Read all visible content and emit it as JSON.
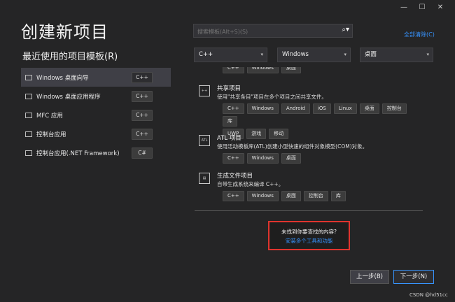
{
  "window": {
    "minimize": "—",
    "maximize": "☐",
    "close": "✕"
  },
  "title": "创建新项目",
  "recent": {
    "heading": "最近使用的项目模板(R)",
    "items": [
      {
        "label": "Windows 桌面向导",
        "tag": "C++",
        "selected": true
      },
      {
        "label": "Windows 桌面应用程序",
        "tag": "C++"
      },
      {
        "label": "MFC 应用",
        "tag": "C++"
      },
      {
        "label": "控制台应用",
        "tag": "C++"
      },
      {
        "label": "控制台应用(.NET Framework)",
        "tag": "C#"
      }
    ]
  },
  "search": {
    "placeholder": "搜索模板(Alt+S)(S)",
    "icon": "search-icon"
  },
  "clear_all": "全部清除(C)",
  "filters": {
    "language": "C++",
    "platform": "Windows",
    "project_type": "桌面"
  },
  "templates": {
    "partial_top_tags": [
      "C++",
      "Windows",
      "桌面"
    ],
    "items": [
      {
        "name": "共享项目",
        "desc": "使用\"共享条目\"项目在多个项目之间共享文件。",
        "tags": [
          "C++",
          "Windows",
          "Android",
          "iOS",
          "Linux",
          "桌面",
          "控制台",
          "库",
          "UWP",
          "游戏",
          "移动"
        ]
      },
      {
        "name": "ATL 项目",
        "desc": "使用活动模板库(ATL)创建小型快速的组件对象模型(COM)对象。",
        "tags": [
          "C++",
          "Windows",
          "桌面"
        ]
      },
      {
        "name": "生成文件项目",
        "desc": "自带生成系统来编译 C++。",
        "tags": [
          "C++",
          "Windows",
          "桌面",
          "控制台",
          "库"
        ]
      }
    ]
  },
  "not_found": {
    "question": "未找到你要查找的内容?",
    "link": "安装多个工具和功能"
  },
  "buttons": {
    "back": "上一步(B)",
    "next": "下一步(N)"
  },
  "watermark": "CSDN @hd51cc",
  "colors": {
    "background": "#252526",
    "accent": "#3794ff",
    "highlight_border": "#e0342e"
  }
}
